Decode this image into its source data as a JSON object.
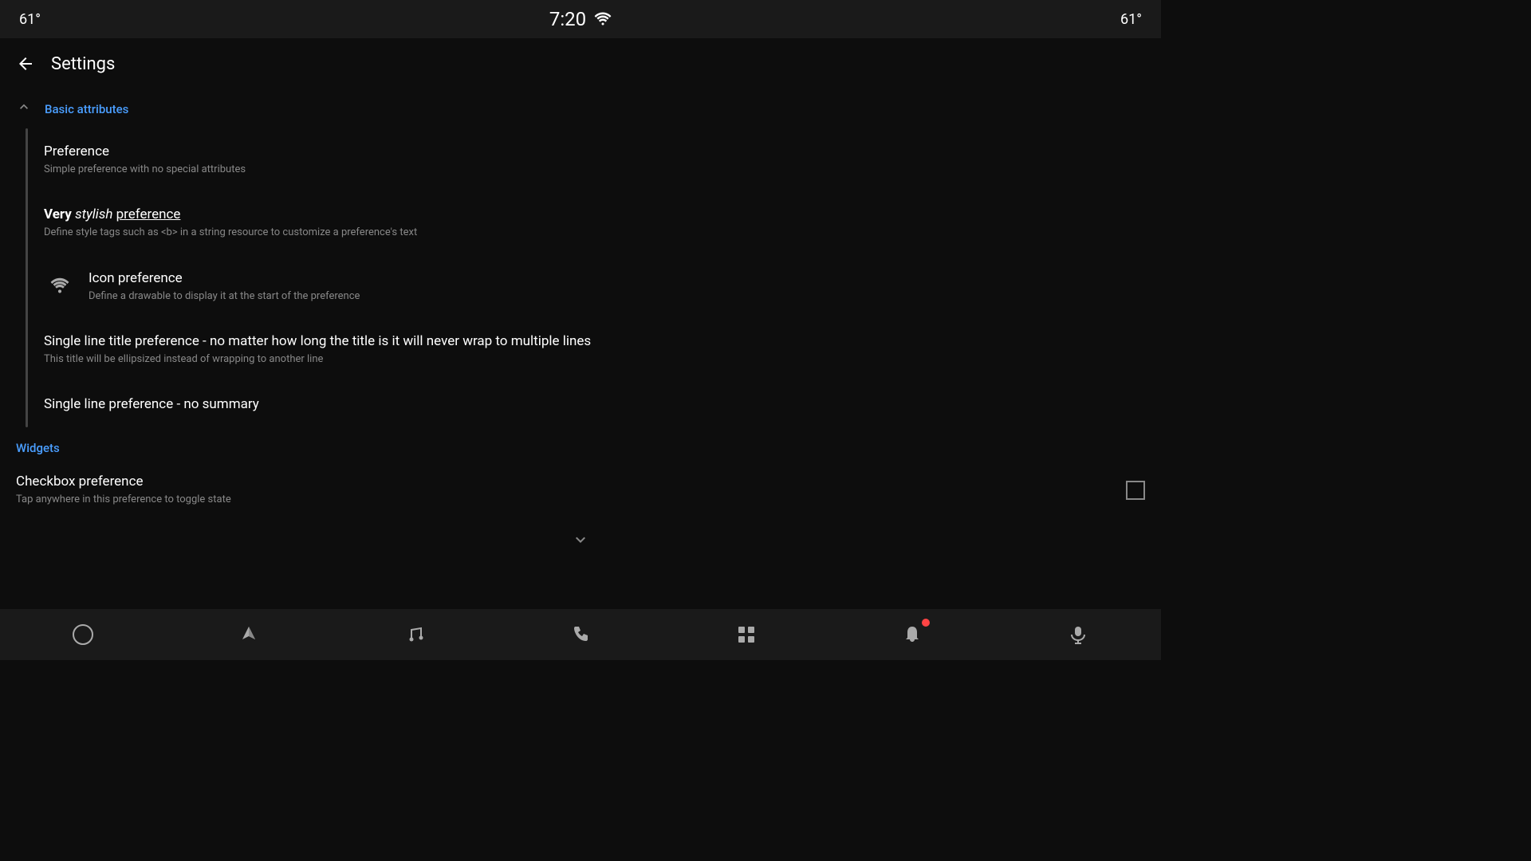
{
  "status_bar": {
    "temp_left": "61°",
    "time": "7:20",
    "temp_right": "61°"
  },
  "top_bar": {
    "back_label": "←",
    "title": "Settings"
  },
  "sections": [
    {
      "id": "basic_attributes",
      "label": "Basic attributes",
      "collapsed": false,
      "chevron": "∧",
      "items": [
        {
          "id": "preference",
          "icon": null,
          "title_plain": "Preference",
          "title_html": null,
          "summary": "Simple preference with no special attributes",
          "widget": null
        },
        {
          "id": "stylish_preference",
          "icon": null,
          "title_plain": null,
          "title_html": "very_stylish",
          "summary": "Define style tags such as <b> in a string resource to customize a preference's text",
          "widget": null
        },
        {
          "id": "icon_preference",
          "icon": "wifi",
          "title_plain": "Icon preference",
          "title_html": null,
          "summary": "Define a drawable to display it at the start of the preference",
          "widget": null
        },
        {
          "id": "single_line_title",
          "icon": null,
          "title_plain": "Single line title preference - no matter how long the title is it will never wrap to multiple lines",
          "title_html": null,
          "summary": "This title will be ellipsized instead of wrapping to another line",
          "widget": null
        },
        {
          "id": "single_line_no_summary",
          "icon": null,
          "title_plain": "Single line preference - no summary",
          "title_html": null,
          "summary": null,
          "widget": null
        }
      ]
    },
    {
      "id": "widgets",
      "label": "Widgets",
      "collapsed": false,
      "chevron": "∨",
      "items": [
        {
          "id": "checkbox_preference",
          "icon": null,
          "title_plain": "Checkbox preference",
          "title_html": null,
          "summary": "Tap anywhere in this preference to toggle state",
          "widget": "checkbox"
        }
      ]
    }
  ],
  "bottom_nav": {
    "items": [
      {
        "id": "home",
        "icon": "circle"
      },
      {
        "id": "navigation",
        "icon": "nav"
      },
      {
        "id": "music",
        "icon": "music"
      },
      {
        "id": "phone",
        "icon": "phone"
      },
      {
        "id": "grid",
        "icon": "grid"
      },
      {
        "id": "bell",
        "icon": "bell",
        "badge": true
      },
      {
        "id": "mic",
        "icon": "mic"
      }
    ]
  }
}
